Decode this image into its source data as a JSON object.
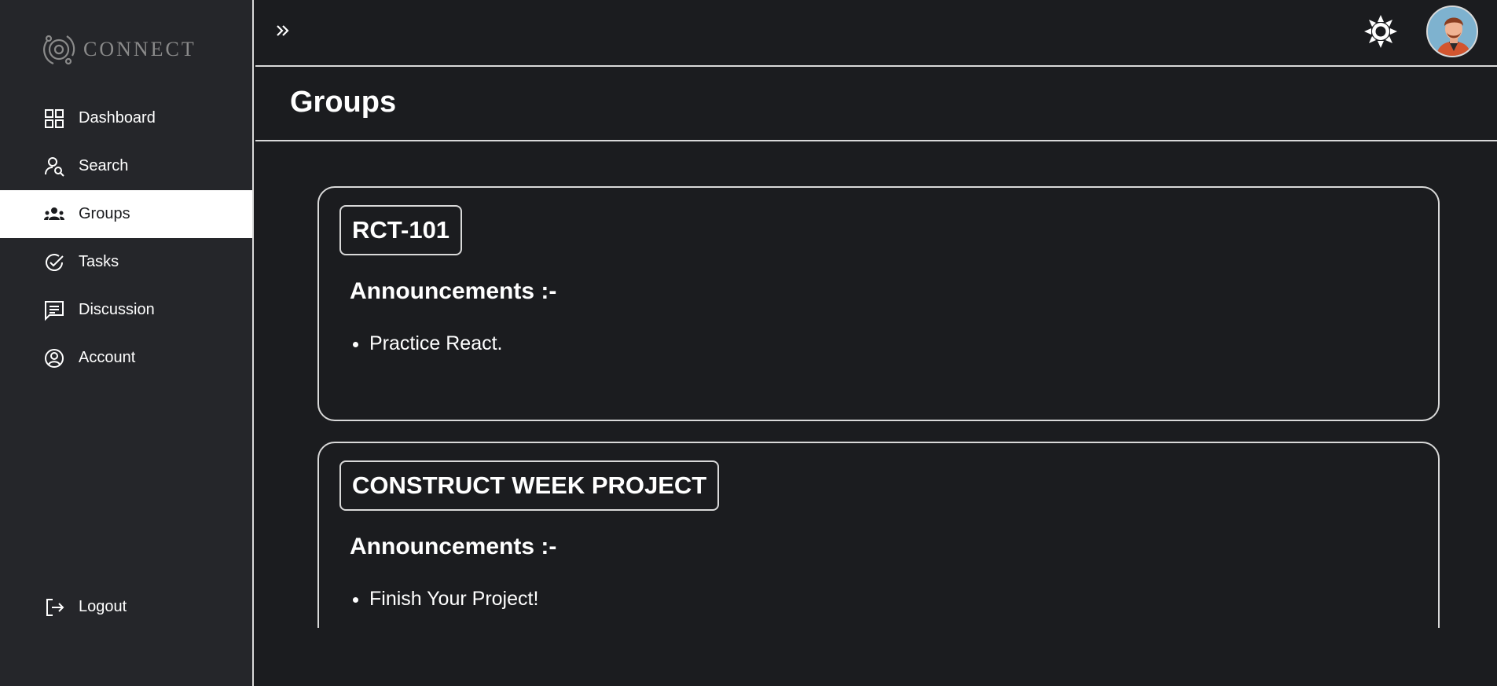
{
  "app": {
    "logo_text": "CONNECT",
    "logo_icon": "orbit-logo-icon"
  },
  "sidebar": {
    "items": [
      {
        "label": "Dashboard",
        "icon": "dashboard-grid-icon",
        "active": false
      },
      {
        "label": "Search",
        "icon": "user-search-icon",
        "active": false
      },
      {
        "label": "Groups",
        "icon": "groups-icon",
        "active": true
      },
      {
        "label": "Tasks",
        "icon": "check-circle-icon",
        "active": false
      },
      {
        "label": "Discussion",
        "icon": "message-square-icon",
        "active": false
      },
      {
        "label": "Account",
        "icon": "account-circle-icon",
        "active": false
      }
    ],
    "logout_label": "Logout"
  },
  "topbar": {
    "expand_icon": "chevrons-right-icon",
    "theme_icon": "sun-icon"
  },
  "page": {
    "title": "Groups"
  },
  "groups": [
    {
      "name": "RCT-101",
      "announcements_heading": "Announcements :-",
      "announcements": [
        "Practice React."
      ]
    },
    {
      "name": "CONSTRUCT WEEK PROJECT",
      "announcements_heading": "Announcements :-",
      "announcements": [
        "Finish Your Project!"
      ]
    }
  ],
  "colors": {
    "background": "#1b1c1f",
    "sidebar": "#25262a",
    "border": "#d9d9d9",
    "active_item_bg": "#ffffff",
    "text": "#ffffff"
  }
}
